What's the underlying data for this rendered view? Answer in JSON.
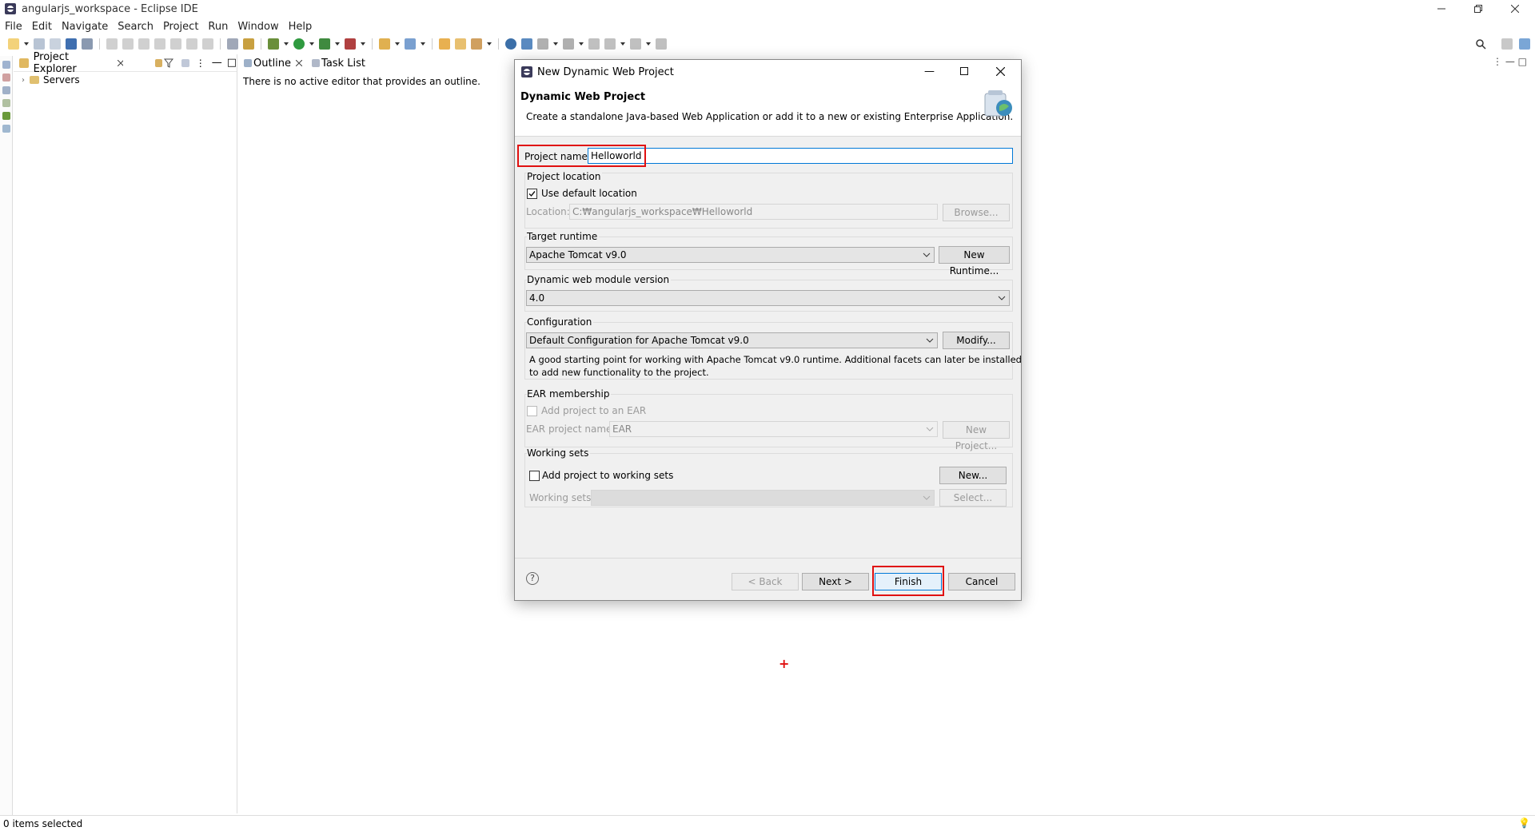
{
  "window": {
    "title": "angularjs_workspace - Eclipse IDE"
  },
  "menu": [
    "File",
    "Edit",
    "Navigate",
    "Search",
    "Project",
    "Run",
    "Window",
    "Help"
  ],
  "project_explorer": {
    "tab_label": "Project Explorer",
    "items": [
      {
        "label": "Servers"
      }
    ]
  },
  "outline": {
    "tab_label": "Outline",
    "task_tab_label": "Task List",
    "message": "There is no active editor that provides an outline."
  },
  "status_bar": {
    "text": "0 items selected"
  },
  "dialog": {
    "title": "New Dynamic Web Project",
    "heading": "Dynamic Web Project",
    "description": "Create a standalone Java-based Web Application or add it to a new or existing Enterprise Application.",
    "project_name_label": "Project name:",
    "project_name_value": "Helloworld",
    "project_location": {
      "group_label": "Project location",
      "use_default_label": "Use default location",
      "use_default_checked": true,
      "location_label": "Location:",
      "location_value": "C:₩angularjs_workspace₩Helloworld",
      "browse_label": "Browse..."
    },
    "target_runtime": {
      "group_label": "Target runtime",
      "value": "Apache Tomcat v9.0",
      "new_runtime_label": "New Runtime..."
    },
    "module_version": {
      "group_label": "Dynamic web module version",
      "value": "4.0"
    },
    "configuration": {
      "group_label": "Configuration",
      "value": "Default Configuration for Apache Tomcat v9.0",
      "modify_label": "Modify...",
      "description_line1": "A good starting point for working with Apache Tomcat v9.0 runtime. Additional facets can later be installed",
      "description_line2": "to add new functionality to the project."
    },
    "ear": {
      "group_label": "EAR membership",
      "add_label": "Add project to an EAR",
      "name_label": "EAR project name:",
      "name_value": "EAR",
      "new_project_label": "New Project..."
    },
    "working_sets": {
      "group_label": "Working sets",
      "add_label": "Add project to working sets",
      "new_label": "New...",
      "sets_label": "Working sets:",
      "select_label": "Select..."
    },
    "buttons": {
      "back": "< Back",
      "next": "Next >",
      "finish": "Finish",
      "cancel": "Cancel",
      "help": "?"
    }
  },
  "colors": {
    "highlight": "#e01010",
    "focus": "#0078d7"
  }
}
